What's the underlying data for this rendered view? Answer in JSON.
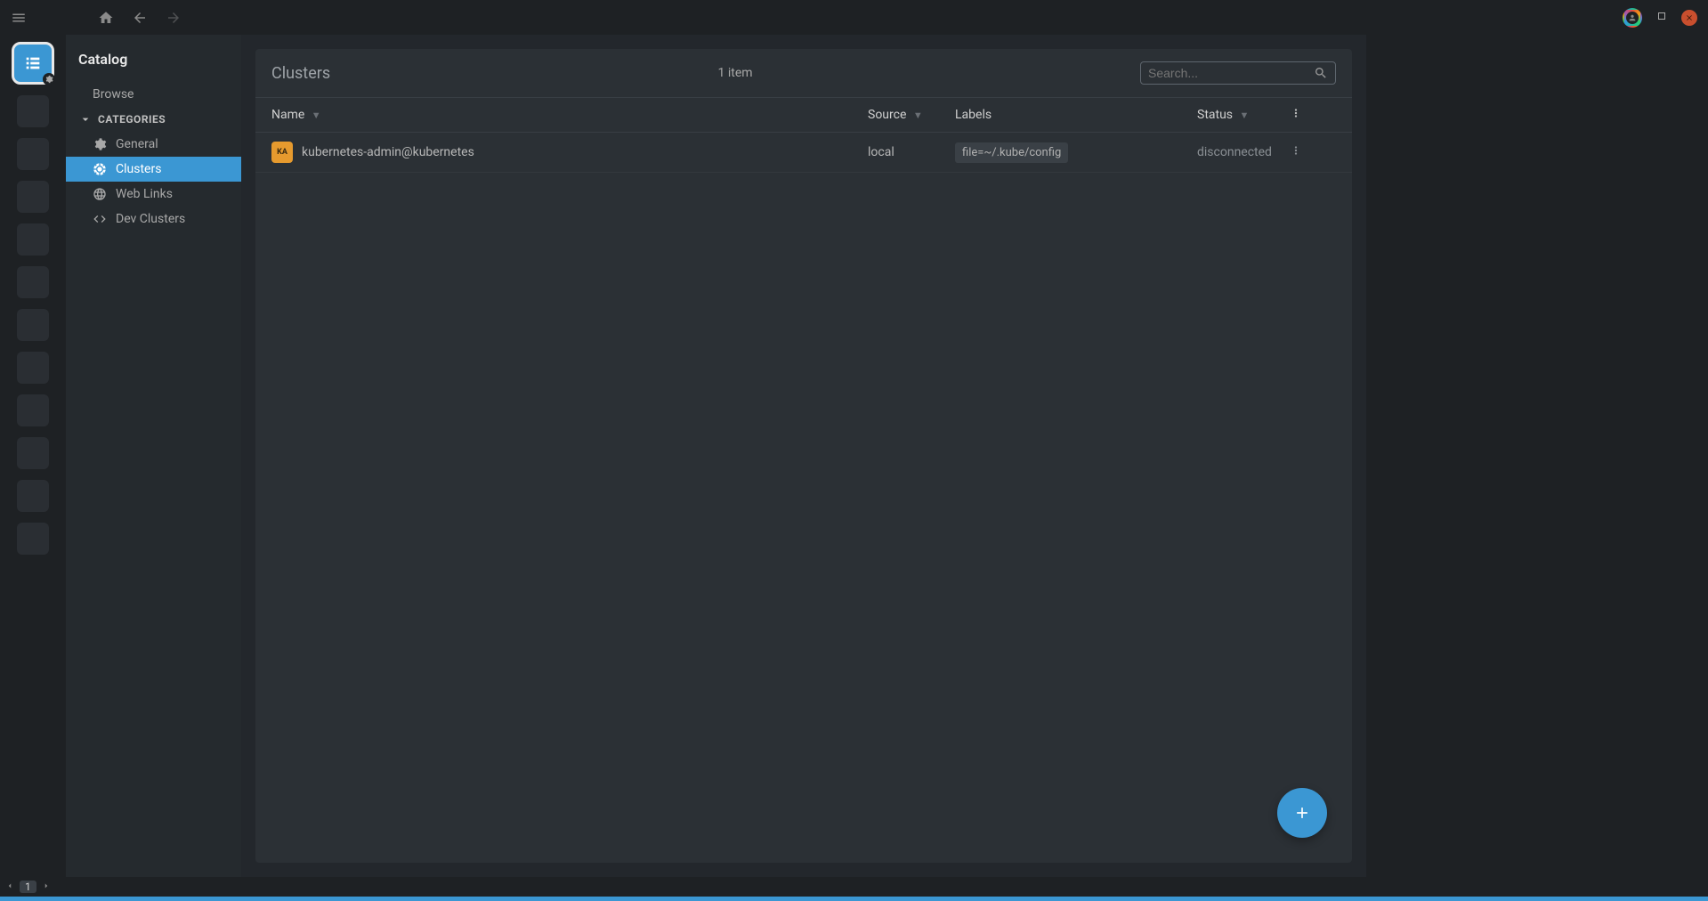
{
  "titlebar": {},
  "sidebar": {
    "title": "Catalog",
    "browse_label": "Browse",
    "categories_label": "CATEGORIES",
    "items": [
      {
        "label": "General",
        "icon": "gear-icon"
      },
      {
        "label": "Clusters",
        "icon": "helm-icon",
        "active": true
      },
      {
        "label": "Web Links",
        "icon": "globe-icon"
      },
      {
        "label": "Dev Clusters",
        "icon": "code-icon"
      }
    ]
  },
  "main": {
    "title": "Clusters",
    "item_count_text": "1 item",
    "search_placeholder": "Search...",
    "columns": {
      "name": "Name",
      "source": "Source",
      "labels": "Labels",
      "status": "Status"
    },
    "rows": [
      {
        "avatar": "KA",
        "name": "kubernetes-admin@kubernetes",
        "source": "local",
        "label": "file=~/.kube/config",
        "status": "disconnected"
      }
    ]
  },
  "footer": {
    "page": "1"
  },
  "colors": {
    "accent": "#3b97d3",
    "avatar_bg": "#e69a2e",
    "close_btn": "#c94f2e"
  }
}
